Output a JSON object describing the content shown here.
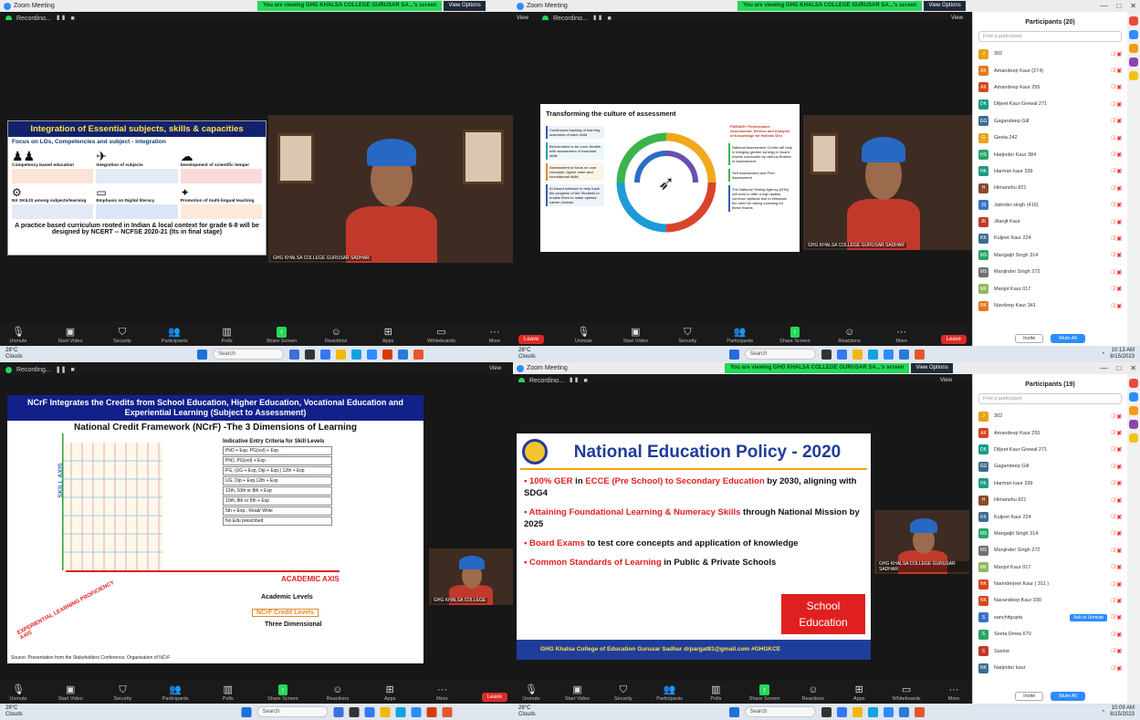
{
  "q1": {
    "window_title": "Zoom Meeting",
    "share_notice": "You are viewing GHG KHALSA COLLEGE GURUSAR SA...'s screen",
    "view_options": "View Options",
    "recording": "Recording...",
    "slide": {
      "title": "Integration of Essential subjects, skills & capacities",
      "subtitle": "Focus on LOs, Competencies and subject - integration",
      "boxes": [
        {
          "heading": "Competency based education"
        },
        {
          "heading": "Integration of subjects"
        },
        {
          "heading": "Development of scientific temper"
        },
        {
          "heading": "NX SKiLlS among subjects/learning"
        },
        {
          "heading": "Emphasis on Digital literacy"
        },
        {
          "heading": "Promotion of multi-lingual teaching"
        }
      ],
      "footer": "A practice based curriculum rooted in Indian & local context for grade 6-8 will be designed by NCERT -- NCFSE 2020-21 (Its in final stage)"
    },
    "cam_label": "GHG KHALSA COLLEGE GURUSAR SADHAR"
  },
  "q2": {
    "window_title": "Zoom Meeting",
    "share_notice": "You are viewing GHG KHALSA COLLEGE GURUSAR SA...'s screen",
    "view_options": "View Options",
    "recording": "Recording...",
    "view": "View",
    "slide": {
      "title": "Transforming the culture of assessment",
      "left_items": [
        "Continuous tracking of learning outcomes of each child",
        "Benchmarks to be more flexible, with assessment of essential skills",
        "Assessment to focus on core concepts, higher order and foundational skills",
        "AI based software to help track the progress of the Students to enable them to make optimal career choices"
      ],
      "right_items": [
        "PARAKH: Performance Assessment, Review and Analysis of Knowledge for Holistic Dev.",
        "National Assessment Centre will help in bringing greater synergy in board exams conducted by various Boards of Assessment",
        "Self Assessment and Peer Assessment",
        "The National Testing Agency (NTA) will work to offer a high quality common aptitude test to eliminate the need for taking coaching for these exams"
      ]
    },
    "cam_label": "GHG KHALSA COLLEGE GURUSAR SADHAR",
    "participants_title": "Participants (20)",
    "find_placeholder": "Find a participant",
    "participants": [
      {
        "initials": "J",
        "name": "302",
        "color": "#e8a317"
      },
      {
        "initials": "AK",
        "name": "Amandeep Kaur (274)",
        "color": "#e5771e"
      },
      {
        "initials": "AK",
        "name": "Amandeep Kaur 255",
        "color": "#d8451d"
      },
      {
        "initials": "DK",
        "name": "Diljeet Kaur Grewal 271",
        "color": "#1a9b82"
      },
      {
        "initials": "GG",
        "name": "Gagandeep Gill",
        "color": "#3c6d8f"
      },
      {
        "initials": "G",
        "name": "Geeta 242",
        "color": "#e8a317"
      },
      {
        "initials": "HS",
        "name": "Harjinder Kaur 384",
        "color": "#2aa567"
      },
      {
        "initials": "HK",
        "name": "Harman kaur 339",
        "color": "#1a9b82"
      },
      {
        "initials": "H",
        "name": "Himanshu 821",
        "color": "#8a4a2e"
      },
      {
        "initials": "JS",
        "name": "Jatinder singh (416)",
        "color": "#3b71c7"
      },
      {
        "initials": "JK",
        "name": "Jitanjit Kaur",
        "color": "#c0392b"
      },
      {
        "initials": "KK",
        "name": "Kuljeet Kaur 224",
        "color": "#3c6d8f"
      },
      {
        "initials": "MS",
        "name": "Mangaljit Singh 314",
        "color": "#2aa567"
      },
      {
        "initials": "MS",
        "name": "Manjinder Singh 272",
        "color": "#6f6f6f"
      },
      {
        "initials": "MK",
        "name": "Manjot Kaur 017",
        "color": "#8fb85a"
      },
      {
        "initials": "NK",
        "name": "Navdeep Kaur 341",
        "color": "#e5771e"
      }
    ],
    "invite": "Invite",
    "mute_all": "Mute All"
  },
  "q3": {
    "recording": "Recording...",
    "view": "View",
    "slide": {
      "banner": "NCrF Integrates the Credits from School Education, Higher Education, Vocational Education and Experiential Learning (Subject to Assessment)",
      "title": "National Credit Framework (NCrF) -The 3 Dimensions of Learning",
      "skill_axis": "SKILL AXIS",
      "academic_axis": "ACADEMIC AXIS",
      "exp_axis": "EXPERIENTIAL LEARNING PROFICIENCY AXIS",
      "entry_title": "Indicative Entry Criteria for Skill Levels",
      "entry_rows": [
        "PhD + Exp. PG(vol) + Exp",
        "PhD, PG(vol) + Exp",
        "PG, (UG + Exp, Dip + Exp,) 12th + Exp",
        "UG, Dip + Exp,12th + Exp",
        "12th, 10th or 8th + Exp",
        "10th, 8th or 5th + Exp",
        "5th + Exp., Read/ Write",
        "No Edu prescribed"
      ],
      "academic_levels": "Academic Levels",
      "credit_levels": "NCrF Credit Levels",
      "three_dim": "Three Dimensional",
      "source": "Source: Presentation from the Stakeholders Conference, Organisation of NCrF"
    },
    "cam_label": "GHG KHALSA COLLEGE"
  },
  "q4": {
    "window_title": "Zoom Meeting",
    "share_notice": "You are viewing GHG KHALSA COLLEGE GURUSAR SA...'s screen",
    "view_options": "View Options",
    "recording": "Recording...",
    "view": "View",
    "slide": {
      "title": "National Education Policy - 2020",
      "bullets": [
        {
          "hl": "100% GER",
          "rest1": " in ",
          "hl2": "ECCE (Pre School) to Secondary Education",
          "rest2": " by 2030, aligning with SDG4"
        },
        {
          "hl": "Attaining Foundational Learning & Numeracy Skills",
          "rest1": " through National Mission by 2025",
          "hl2": "",
          "rest2": ""
        },
        {
          "hl": "Board Exams",
          "rest1": " to test core concepts and application of knowledge",
          "hl2": "",
          "rest2": ""
        },
        {
          "hl": "Common Standards of Learning",
          "rest1": " in Public & Private Schools",
          "hl2": "",
          "rest2": ""
        }
      ],
      "badge_line1": "School",
      "badge_line2": "Education",
      "footer": "GHG Khalsa College of Education Gurusar Sadhar   drpargat81@gmail.com  #GHGKCE"
    },
    "cam_label": "GHG KHALSA COLLEGE GURUSAR SADHAR",
    "participants_title": "Participants (19)",
    "find_placeholder": "Find a participant",
    "participants": [
      {
        "initials": "J",
        "name": "302",
        "color": "#e8a317"
      },
      {
        "initials": "AK",
        "name": "Amandeep Kaur 255",
        "color": "#d8451d"
      },
      {
        "initials": "DK",
        "name": "Diljeet Kaur Grewal 271",
        "color": "#1a9b82"
      },
      {
        "initials": "GG",
        "name": "Gagandeep Gill",
        "color": "#3c6d8f"
      },
      {
        "initials": "HK",
        "name": "Harman kaur 339",
        "color": "#1a9b82"
      },
      {
        "initials": "H",
        "name": "Himanshu 821",
        "color": "#8a4a2e"
      },
      {
        "initials": "KK",
        "name": "Kuljeet Kaur 224",
        "color": "#3c6d8f"
      },
      {
        "initials": "MS",
        "name": "Mangaljit Singh 314",
        "color": "#2aa567"
      },
      {
        "initials": "MS",
        "name": "Manjinder Singh 272",
        "color": "#6f6f6f"
      },
      {
        "initials": "MK",
        "name": "Manjot Kaur 017",
        "color": "#8fb85a"
      },
      {
        "initials": "NK",
        "name": "Narinderjeet Kaur ( 311 )",
        "color": "#d8451d"
      },
      {
        "initials": "NK",
        "name": "Navandeep Kaur 330",
        "color": "#d8451d"
      },
      {
        "initials": "S",
        "name": "sanchitgupta",
        "color": "#3b71c7",
        "action": "Ask to Unmute"
      },
      {
        "initials": "S",
        "name": "Seeta Dewa 670",
        "color": "#2aa567"
      },
      {
        "initials": "S",
        "name": "Samist",
        "color": "#c0392b"
      },
      {
        "initials": "NK",
        "name": "Narjinder kaur",
        "color": "#3c6d8f"
      }
    ],
    "invite": "Invite",
    "mute_all": "Mute All"
  },
  "toolbar": {
    "items": [
      "Unmute",
      "Start Video",
      "Security",
      "Participants",
      "Polls",
      "Share Screen",
      "Reactions",
      "Apps",
      "Whiteboards",
      "More"
    ],
    "participants_count": "20",
    "participants_count_b": "19",
    "leave": "Leave"
  },
  "taskbar": {
    "weather_temp": "28°C",
    "weather_desc": "Clouds",
    "search": "Search",
    "lang": "ENG\nIN",
    "time": "10:13 AM",
    "date": "8/15/2023",
    "time_b": "10:09 AM",
    "date_b": "8/15/2023"
  },
  "colors": {
    "zoom_blue": "#2d8cff",
    "share_green": "#23d959",
    "leave_red": "#e02828",
    "nep_title": "#1f3d9a",
    "nep_badge": "#e02020"
  }
}
